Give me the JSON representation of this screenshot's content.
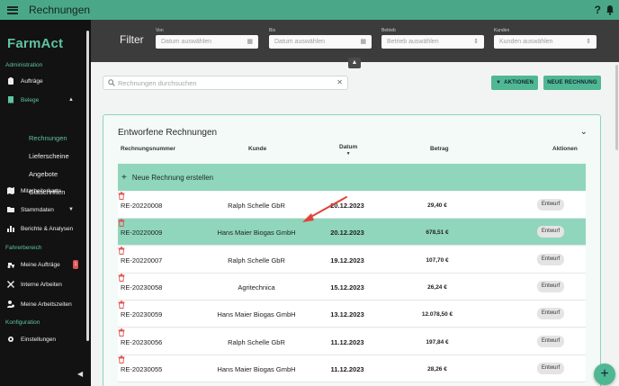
{
  "topbar": {
    "title": "Rechnungen",
    "help": "?"
  },
  "sidebar": {
    "logo": "FarmAct",
    "sections": {
      "admin": "Administration",
      "fahrer": "Fahrerbereich",
      "config": "Konfiguration"
    },
    "items": {
      "auftraege": "Aufträge",
      "belege": "Belege",
      "mitarbeiterkarte": "Mitarbeiterkarte",
      "stammdaten": "Stammdaten",
      "berichte": "Berichte & Analysen",
      "meine_auftraege": "Meine Aufträge",
      "interne_arbeiten": "Interne Arbeiten",
      "meine_arbeitszeiten": "Meine Arbeitszeiten",
      "einstellungen": "Einstellungen"
    },
    "belege_sub": [
      "Rechnungen",
      "Lieferscheine",
      "Angebote",
      "Gutschriften"
    ],
    "badge": "1"
  },
  "filter": {
    "title": "Filter",
    "von": {
      "label": "Von",
      "placeholder": "Datum auswählen"
    },
    "bis": {
      "label": "Bis",
      "placeholder": "Datum auswählen"
    },
    "betrieb": {
      "label": "Betrieb",
      "placeholder": "Betrieb auswählen"
    },
    "kunden": {
      "label": "Kunden",
      "placeholder": "Kunden auswählen"
    }
  },
  "search": {
    "placeholder": "Rechnungen durchsuchen"
  },
  "actions": {
    "aktionen": "AKTIONEN",
    "neue_rechnung": "NEUE RECHNUNG"
  },
  "card": {
    "title": "Entworfene Rechnungen",
    "columns": {
      "nummer": "Rechnungsnummer",
      "kunde": "Kunde",
      "datum": "Datum",
      "betrag": "Betrag",
      "aktionen": "Aktionen"
    },
    "new_row": "Neue Rechnung erstellen",
    "rows": [
      {
        "nummer": "RE-20220008",
        "kunde": "Ralph Schelle GbR",
        "datum": "20.12.2023",
        "betrag": "29,40 €",
        "status": "Entwurf"
      },
      {
        "nummer": "RE-20220009",
        "kunde": "Hans Maier Biogas GmbH",
        "datum": "20.12.2023",
        "betrag": "678,51 €",
        "status": "Entwurf"
      },
      {
        "nummer": "RE-20220007",
        "kunde": "Ralph Schelle GbR",
        "datum": "19.12.2023",
        "betrag": "107,70 €",
        "status": "Entwurf"
      },
      {
        "nummer": "RE-20230058",
        "kunde": "Agritechnica",
        "datum": "15.12.2023",
        "betrag": "26,24 €",
        "status": "Entwurf"
      },
      {
        "nummer": "RE-20230059",
        "kunde": "Hans Maier Biogas GmbH",
        "datum": "13.12.2023",
        "betrag": "12.078,50 €",
        "status": "Entwurf"
      },
      {
        "nummer": "RE-20230056",
        "kunde": "Ralph Schelle GbR",
        "datum": "11.12.2023",
        "betrag": "197,84 €",
        "status": "Entwurf"
      },
      {
        "nummer": "RE-20230055",
        "kunde": "Hans Maier Biogas GmbH",
        "datum": "11.12.2023",
        "betrag": "28,26 €",
        "status": "Entwurf"
      }
    ]
  },
  "colors": {
    "accent": "#4fb893",
    "selected_row": "#8fd6bd",
    "sidebar_bg": "#121212",
    "annotation_arrow": "#e0453a"
  }
}
